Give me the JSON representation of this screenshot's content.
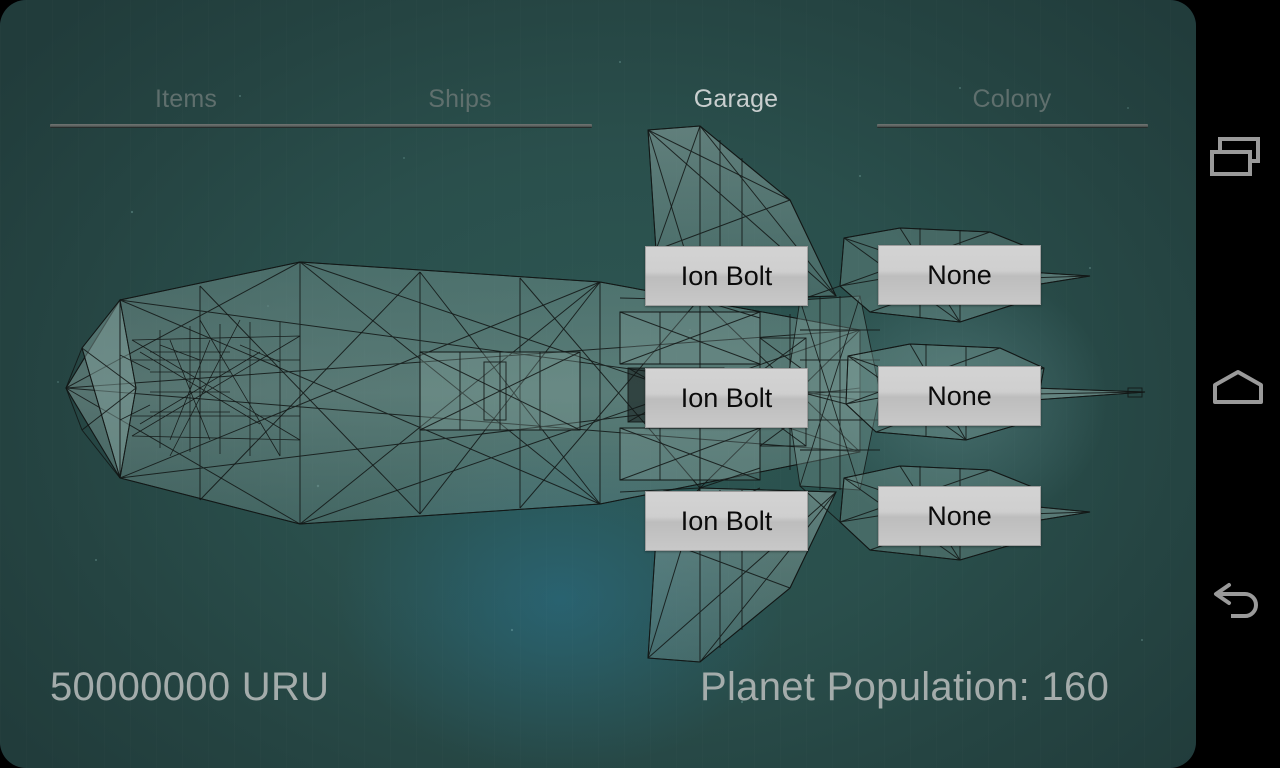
{
  "app": {
    "screen_name": "Garage",
    "theme": {
      "background_teal": "#26443f",
      "glow_blue": "#286e87",
      "tab_active_color": "#c9cfcf",
      "tab_inactive_color": "#5f6f6d",
      "button_face": "#cfcfcf",
      "button_text": "#0b0b0b",
      "status_text_color": "#a4acab",
      "navbar_background": "#000000",
      "navbar_icon_color": "#9a9a9a"
    }
  },
  "tabs": [
    {
      "label": "Items",
      "active": false,
      "underlined": true
    },
    {
      "label": "Ships",
      "active": false,
      "underlined": true
    },
    {
      "label": "Garage",
      "active": true,
      "underlined": false
    },
    {
      "label": "Colony",
      "active": false,
      "underlined": true
    }
  ],
  "weapon_slots": {
    "left_column": [
      {
        "label": "Ion Bolt"
      },
      {
        "label": "Ion Bolt"
      },
      {
        "label": "Ion Bolt"
      }
    ],
    "right_column": [
      {
        "label": "None"
      },
      {
        "label": "None"
      },
      {
        "label": "None"
      }
    ]
  },
  "status": {
    "currency": "50000000 URU",
    "population": "Planet Population: 160"
  },
  "navbar": {
    "items": [
      {
        "icon": "recents-icon",
        "label": "Recents"
      },
      {
        "icon": "home-icon",
        "label": "Home"
      },
      {
        "icon": "back-icon",
        "label": "Back"
      }
    ]
  },
  "ship_preview": {
    "description": "Wireframe spaceship top-down view"
  }
}
